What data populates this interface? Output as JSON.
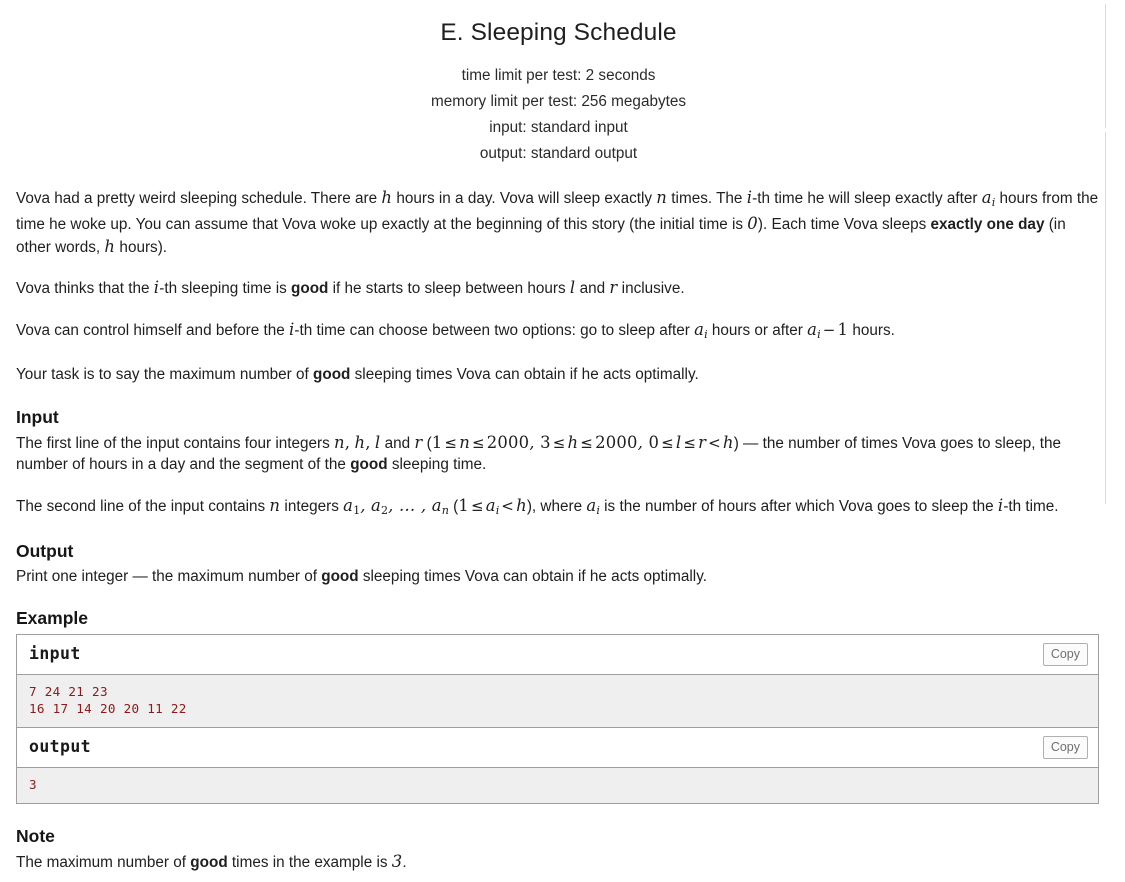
{
  "header": {
    "title": "E. Sleeping Schedule",
    "time_limit": "time limit per test: 2 seconds",
    "memory_limit": "memory limit per test: 256 megabytes",
    "input_spec": "input: standard input",
    "output_spec": "output: standard output"
  },
  "statement": {
    "p1_a": "Vova had a pretty weird sleeping schedule. There are ",
    "p1_h": "h",
    "p1_b": " hours in a day. Vova will sleep exactly ",
    "p1_n": "n",
    "p1_c": " times. The ",
    "p1_i": "i",
    "p1_d": "-th time he will sleep exactly after ",
    "p1_ai": "a",
    "p1_ai_sub": "i",
    "p1_e": " hours from the time he woke up. You can assume that Vova woke up exactly at the beginning of this story (the initial time is ",
    "p1_zero": "0",
    "p1_f": "). Each time Vova sleeps ",
    "p1_bold": "exactly one day",
    "p1_g": " (in other words, ",
    "p1_h2": "h",
    "p1_i2": " hours).",
    "p2_a": "Vova thinks that the ",
    "p2_i": "i",
    "p2_b": "-th sleeping time is ",
    "p2_bold": "good",
    "p2_c": " if he starts to sleep between hours ",
    "p2_l": "l",
    "p2_d": " and ",
    "p2_r": "r",
    "p2_e": " inclusive.",
    "p3_a": "Vova can control himself and before the ",
    "p3_i": "i",
    "p3_b": "-th time can choose between two options: go to sleep after ",
    "p3_ai": "a",
    "p3_ai_sub": "i",
    "p3_c": " hours or after ",
    "p3_ai2": "a",
    "p3_ai2_sub": "i",
    "p3_minus": "−",
    "p3_one": "1",
    "p3_d": " hours.",
    "p4_a": "Your task is to say the maximum number of ",
    "p4_bold": "good",
    "p4_b": " sleeping times Vova can obtain if he acts optimally."
  },
  "input_section": {
    "heading": "Input",
    "s1_a": "The first line of the input contains four integers ",
    "s1_n": "n",
    "s1_comma1": ",",
    "s1_h": "h",
    "s1_comma2": ",",
    "s1_l": "l",
    "s1_b": " and ",
    "s1_r": "r",
    "s1_c": " (",
    "s1_c1_1": "1",
    "s1_le1": "≤",
    "s1_c1_n": "n",
    "s1_le2": "≤",
    "s1_c1_2000": "2000",
    "s1_comma3": ",",
    "s1_c2_3": "3",
    "s1_le3": "≤",
    "s1_c2_h": "h",
    "s1_le4": "≤",
    "s1_c2_2000": "2000",
    "s1_comma4": ",",
    "s1_c3_0": "0",
    "s1_le5": "≤",
    "s1_c3_l": "l",
    "s1_le6": "≤",
    "s1_c3_r": "r",
    "s1_lt": "<",
    "s1_c3_h": "h",
    "s1_d": ") — the number of times Vova goes to sleep, the number of hours in a day and the segment of the ",
    "s1_bold": "good",
    "s1_e": " sleeping time.",
    "s2_a": "The second line of the input contains ",
    "s2_n": "n",
    "s2_b": " integers ",
    "s2_a1": "a",
    "s2_a1_sub": "1",
    "s2_comma1": ",",
    "s2_a2": "a",
    "s2_a2_sub": "2",
    "s2_dots": ", … ,",
    "s2_an": "a",
    "s2_an_sub": "n",
    "s2_c": " (",
    "s2_one": "1",
    "s2_le": "≤",
    "s2_ai": "a",
    "s2_ai_sub": "i",
    "s2_lt": "<",
    "s2_h": "h",
    "s2_d": "), where ",
    "s2_ai2": "a",
    "s2_ai2_sub": "i",
    "s2_e": " is the number of hours after which Vova goes to sleep the ",
    "s2_i": "i",
    "s2_f": "-th time."
  },
  "output_section": {
    "heading": "Output",
    "text_a": "Print one integer — the maximum number of ",
    "text_bold": "good",
    "text_b": " sleeping times Vova can obtain if he acts optimally."
  },
  "example_section": {
    "heading": "Example",
    "tests": [
      {
        "input_label": "input",
        "input_copy_label": "Copy",
        "input_content": "7 24 21 23\n16 17 14 20 20 11 22",
        "output_label": "output",
        "output_copy_label": "Copy",
        "output_content": "3"
      }
    ]
  },
  "note_section": {
    "heading": "Note",
    "text_a": "The maximum number of ",
    "text_bold": "good",
    "text_b": " times in the example is ",
    "text_num": "3",
    "text_c": "."
  },
  "colors": {
    "sample_text": "#8b1a1a",
    "sample_bg": "#efefef",
    "border": "#9e9e9e",
    "text": "#1f1f1f"
  }
}
